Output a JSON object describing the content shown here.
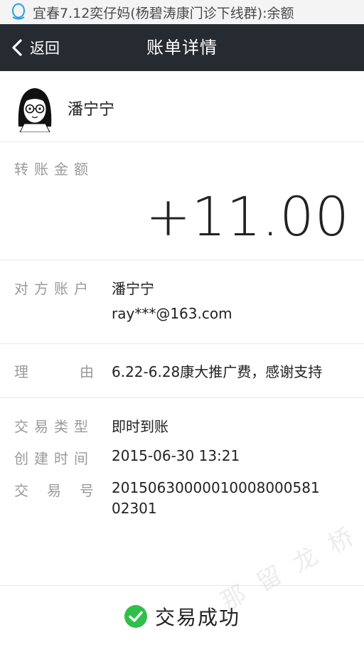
{
  "status_bar": {
    "notification": "宜春7.12奕仔妈(杨碧涛康门诊下线群):余额"
  },
  "header": {
    "back_label": "返回",
    "title": "账单详情"
  },
  "contact": {
    "name": "潘宁宁"
  },
  "transfer": {
    "label": "转账金额",
    "amount": "+11.00"
  },
  "account": {
    "label": "对方账户",
    "name": "潘宁宁",
    "email": "ray***@163.com"
  },
  "reason": {
    "label_left": "理",
    "label_right": "由",
    "value": "6.22-6.28康大推广费，感谢支持"
  },
  "trade_type": {
    "label": "交易类型",
    "value": "即时到账"
  },
  "created_time": {
    "label": "创建时间",
    "value": "2015-06-30 13:21"
  },
  "trade_no": {
    "label_1": "交",
    "label_2": "易",
    "label_3": "号",
    "line_1": "20150630000010008000581",
    "line_2": "02301"
  },
  "result": {
    "text": "交易成功",
    "color": "#2ec04a"
  },
  "watermark": "那 留 龙 桥"
}
